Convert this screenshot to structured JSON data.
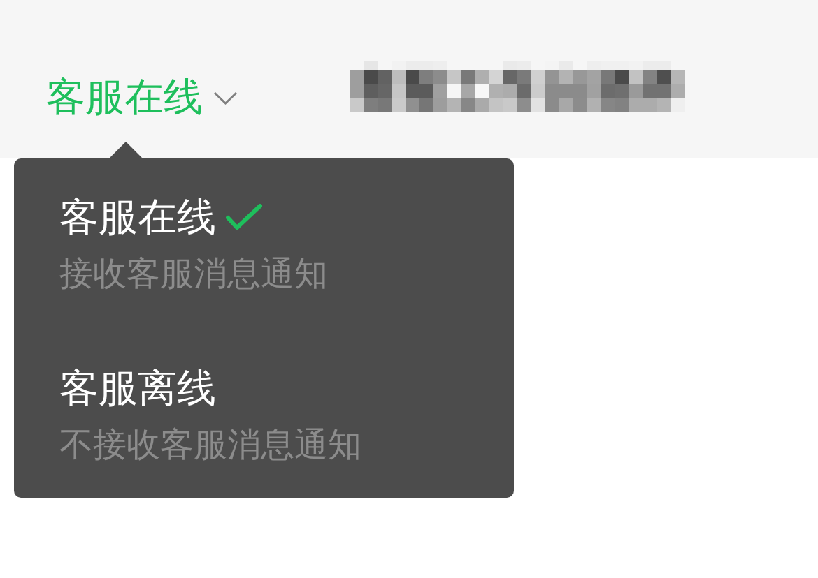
{
  "header": {
    "status": {
      "label": "客服在线",
      "expanded": true
    }
  },
  "menu": {
    "items": [
      {
        "title": "客服在线",
        "description": "接收客服消息通知",
        "selected": true
      },
      {
        "title": "客服离线",
        "description": "不接收客服消息通知",
        "selected": false
      }
    ]
  }
}
